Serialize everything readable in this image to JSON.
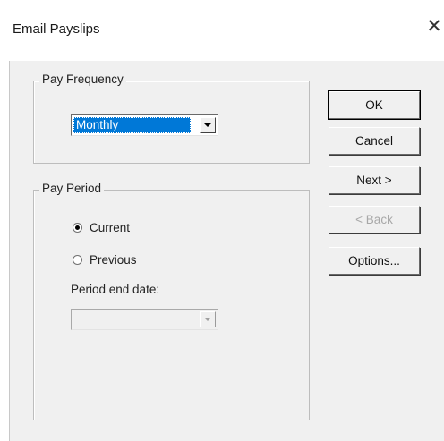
{
  "window": {
    "title": "Email Payslips",
    "close_glyph": "✕"
  },
  "pay_frequency": {
    "legend": "Pay Frequency",
    "selected": "Monthly"
  },
  "pay_period": {
    "legend": "Pay Period",
    "options": [
      {
        "label": "Current",
        "checked": true
      },
      {
        "label": "Previous",
        "checked": false
      }
    ],
    "end_date_label": "Period end date:",
    "end_date_value": ""
  },
  "buttons": {
    "ok": "OK",
    "cancel": "Cancel",
    "next": "Next >",
    "back": "< Back",
    "options": "Options..."
  },
  "colors": {
    "selection": "#0078d7",
    "face": "#f0f0f0"
  }
}
